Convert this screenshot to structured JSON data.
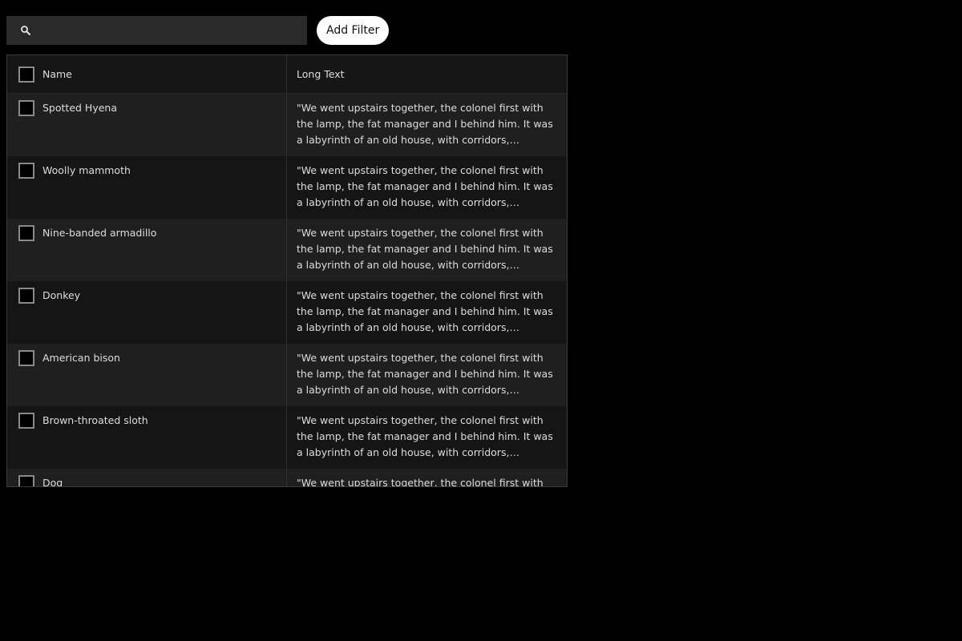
{
  "toolbar": {
    "search_placeholder": "",
    "search_value": "",
    "add_filter_label": "Add Filter"
  },
  "grid": {
    "columns": [
      "Name",
      "Long Text"
    ],
    "rows": [
      {
        "name": "Spotted Hyena",
        "text": "\"We went upstairs together, the colonel first with the lamp, the fat manager and I behind him. It was a labyrinth of an old house, with corridors, passages, narrow winding staircases, and little low doors."
      },
      {
        "name": "Woolly mammoth",
        "text": "\"We went upstairs together, the colonel first with the lamp, the fat manager and I behind him. It was a labyrinth of an old house, with corridors, passages, narrow winding staircases, and little low doors."
      },
      {
        "name": "Nine-banded armadillo",
        "text": "\"We went upstairs together, the colonel first with the lamp, the fat manager and I behind him. It was a labyrinth of an old house, with corridors, passages, narrow winding staircases, and little low doors."
      },
      {
        "name": "Donkey",
        "text": "\"We went upstairs together, the colonel first with the lamp, the fat manager and I behind him. It was a labyrinth of an old house, with corridors, passages, narrow winding staircases, and little low doors."
      },
      {
        "name": "American bison",
        "text": "\"We went upstairs together, the colonel first with the lamp, the fat manager and I behind him. It was a labyrinth of an old house, with corridors, passages, narrow winding staircases, and little low doors."
      },
      {
        "name": "Brown-throated sloth",
        "text": "\"We went upstairs together, the colonel first with the lamp, the fat manager and I behind him. It was a labyrinth of an old house, with corridors, passages, narrow winding staircases, and little low doors."
      },
      {
        "name": "Dog",
        "text": "\"We went upstairs together, the colonel first with the lamp, the fat manager and I behind him. It was a labyrinth of an old house, with corridors, passages, narrow winding staircases, and little low doors."
      }
    ]
  },
  "icons": {
    "search": "search-icon",
    "checkbox": "checkbox-unchecked"
  },
  "colors": {
    "background": "#000000",
    "search_bg": "#2a2a2a",
    "button_bg": "#ffffff",
    "row_odd": "#1f1f1f",
    "row_even": "#151515",
    "checkbox_border": "#8a8a8a"
  }
}
